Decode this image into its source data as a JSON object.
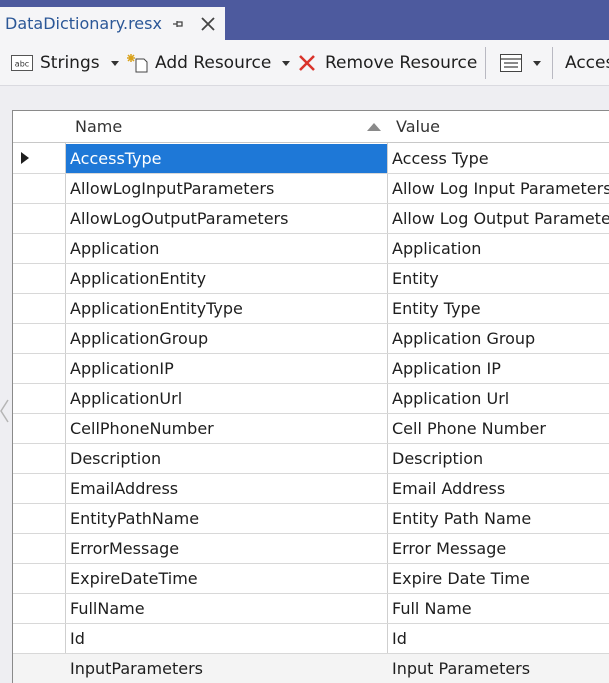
{
  "tab": {
    "title": "DataDictionary.resx"
  },
  "toolbar": {
    "strings_label": "Strings",
    "add_label": "Add Resource",
    "remove_label": "Remove Resource",
    "access_label": "Acces"
  },
  "grid": {
    "columns": {
      "name": "Name",
      "value": "Value"
    },
    "rows": [
      {
        "name": "AccessType",
        "value": "Access Type"
      },
      {
        "name": "AllowLogInputParameters",
        "value": "Allow Log Input Parameters"
      },
      {
        "name": "AllowLogOutputParameters",
        "value": "Allow Log Output Parameters"
      },
      {
        "name": "Application",
        "value": "Application"
      },
      {
        "name": "ApplicationEntity",
        "value": "Entity"
      },
      {
        "name": "ApplicationEntityType",
        "value": "Entity Type"
      },
      {
        "name": "ApplicationGroup",
        "value": "Application Group"
      },
      {
        "name": "ApplicationIP",
        "value": "Application IP"
      },
      {
        "name": "ApplicationUrl",
        "value": "Application Url"
      },
      {
        "name": "CellPhoneNumber",
        "value": "Cell Phone Number"
      },
      {
        "name": "Description",
        "value": "Description"
      },
      {
        "name": "EmailAddress",
        "value": "Email Address"
      },
      {
        "name": "EntityPathName",
        "value": "Entity Path Name"
      },
      {
        "name": "ErrorMessage",
        "value": "Error Message"
      },
      {
        "name": "ExpireDateTime",
        "value": "Expire Date Time"
      },
      {
        "name": "FullName",
        "value": "Full Name"
      },
      {
        "name": "Id",
        "value": "Id"
      },
      {
        "name": "InputParameters",
        "value": "Input Parameters"
      }
    ]
  },
  "colors": {
    "accent": "#1e78d7",
    "tabstrip": "#4d5a9e",
    "remove_red": "#d9332b"
  }
}
